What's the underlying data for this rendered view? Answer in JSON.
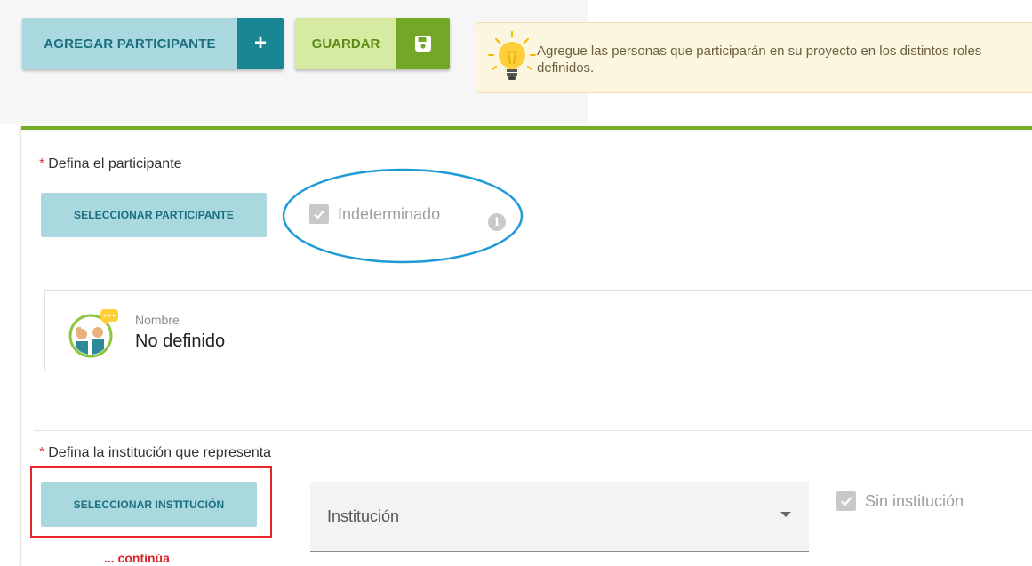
{
  "toolbar": {
    "add_participant_label": "AGREGAR PARTICIPANTE",
    "add_icon": "+",
    "save_label": "GUARDAR"
  },
  "hint": {
    "icon": "lightbulb-icon",
    "text": "Agregue las personas que participarán en su proyecto en los distintos roles definidos."
  },
  "participant_section": {
    "required_mark": "*",
    "label": "Defina el participante",
    "select_button": "SELECCIONAR PARTICIPANTE",
    "indeterminate_label": "Indeterminado",
    "indeterminate_checked": true,
    "info_icon": "i"
  },
  "participant_card": {
    "name_label": "Nombre",
    "name_value": "No definido"
  },
  "institution_section": {
    "required_mark": "*",
    "label": "Defina la institución que representa",
    "select_button": "SELECCIONAR INSTITUCIÓN",
    "institution_placeholder": "Institución",
    "no_institution_label": "Sin institución",
    "no_institution_checked": true
  },
  "annotation": {
    "continues_text": "... continúa"
  },
  "colors": {
    "accent_teal": "#1a8593",
    "accent_green": "#73a728",
    "highlight_ellipse": "#1e9bd7",
    "highlight_box": "#e4262a"
  }
}
